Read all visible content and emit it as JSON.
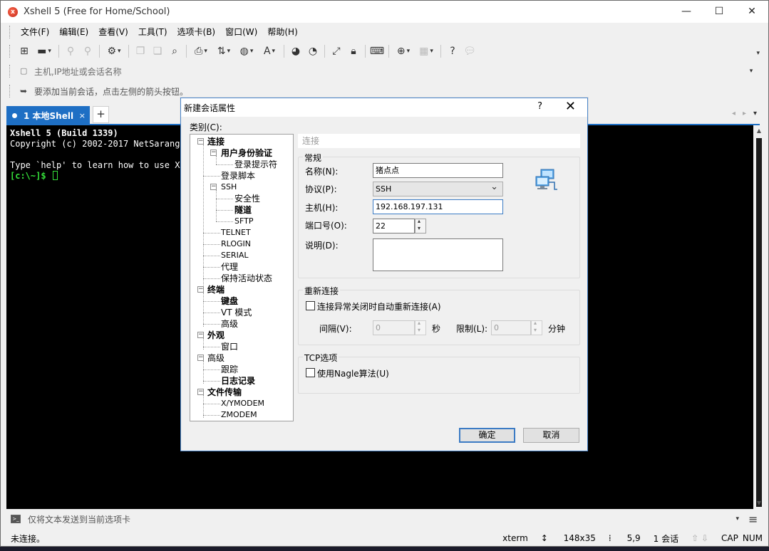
{
  "window": {
    "title": "Xshell 5 (Free for Home/School)"
  },
  "menu": [
    "文件(F)",
    "编辑(E)",
    "查看(V)",
    "工具(T)",
    "选项卡(B)",
    "窗口(W)",
    "帮助(H)"
  ],
  "address": {
    "placeholder": "主机,IP地址或会话名称"
  },
  "hint": {
    "text": "要添加当前会话，点击左侧的箭头按钮。"
  },
  "tabs": {
    "active_label": "1 本地Shell",
    "close": "×",
    "add": "+"
  },
  "terminal": {
    "lines": [
      "Xshell 5 (Build 1339)",
      "Copyright (c) 2002-2017 NetSarang (",
      "",
      "Type `help' to learn how to use Xsh"
    ],
    "prompt": "[c:\\~]$ "
  },
  "compose": {
    "placeholder": "仅将文本发送到当前选项卡"
  },
  "status": {
    "left": "未连接。",
    "term": "xterm",
    "size": "148x35",
    "pos": "5,9",
    "sessions": "1 会话",
    "cap": "CAP",
    "num": "NUM"
  },
  "dialog": {
    "title": "新建会话属性",
    "help": "?",
    "close": "✕",
    "category_label": "类别(C):",
    "tree": [
      {
        "label": "连接",
        "bold": true
      },
      {
        "label": "用户身份验证",
        "bold": true
      },
      {
        "label": "登录提示符",
        "bold": false
      },
      {
        "label": "登录脚本",
        "bold": false
      },
      {
        "label": "SSH",
        "bold": false
      },
      {
        "label": "安全性",
        "bold": false
      },
      {
        "label": "隧道",
        "bold": true
      },
      {
        "label": "SFTP",
        "bold": false
      },
      {
        "label": "TELNET",
        "bold": false
      },
      {
        "label": "RLOGIN",
        "bold": false
      },
      {
        "label": "SERIAL",
        "bold": false
      },
      {
        "label": "代理",
        "bold": false
      },
      {
        "label": "保持活动状态",
        "bold": false
      },
      {
        "label": "终端",
        "bold": true
      },
      {
        "label": "键盘",
        "bold": true
      },
      {
        "label": "VT 模式",
        "bold": false
      },
      {
        "label": "高级",
        "bold": false
      },
      {
        "label": "外观",
        "bold": true
      },
      {
        "label": "窗口",
        "bold": false
      },
      {
        "label": "高级",
        "bold": false
      },
      {
        "label": "跟踪",
        "bold": false
      },
      {
        "label": "日志记录",
        "bold": true
      },
      {
        "label": "文件传输",
        "bold": true
      },
      {
        "label": "X/YMODEM",
        "bold": false
      },
      {
        "label": "ZMODEM",
        "bold": false
      }
    ],
    "panel_title": "连接",
    "general": {
      "title": "常规",
      "name_label": "名称(N):",
      "name_value": "猪点点",
      "protocol_label": "协议(P):",
      "protocol_value": "SSH",
      "host_label": "主机(H):",
      "host_value": "192.168.197.131",
      "port_label": "端口号(O):",
      "port_value": "22",
      "desc_label": "说明(D):",
      "desc_value": ""
    },
    "reconnect": {
      "title": "重新连接",
      "auto_label": "连接异常关闭时自动重新连接(A)",
      "interval_label": "间隔(V):",
      "interval_value": "0",
      "sec_unit": "秒",
      "limit_label": "限制(L):",
      "limit_value": "0",
      "min_unit": "分钟"
    },
    "tcp": {
      "title": "TCP选项",
      "nagle_label": "使用Nagle算法(U)"
    },
    "ok": "确定",
    "cancel": "取消"
  }
}
